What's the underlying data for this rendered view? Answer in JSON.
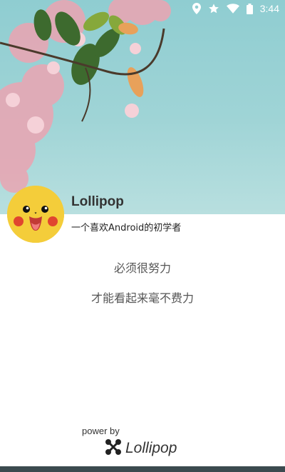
{
  "status_bar": {
    "time": "3:44",
    "icons": [
      "location-icon",
      "star-icon",
      "wifi-icon",
      "battery-icon"
    ]
  },
  "header": {
    "image": "blossom-branch-sky",
    "colors": {
      "sky": "#9fd4d6",
      "blossom": "#e7a7b4",
      "leaf": "#3d6a2e"
    }
  },
  "profile": {
    "avatar": "pikachu-face",
    "name": "Lollipop",
    "bio": "一个喜欢Android的初学者"
  },
  "content": {
    "line1": "必须很努力",
    "line2": "才能看起来毫不费力"
  },
  "footer": {
    "powered_by": "power by",
    "brand": "Lollipop",
    "brand_icon": "lollipop-logo-icon"
  },
  "colors": {
    "avatar_bg": "#f4cd3a",
    "nav_bar": "#3b4a4f"
  }
}
